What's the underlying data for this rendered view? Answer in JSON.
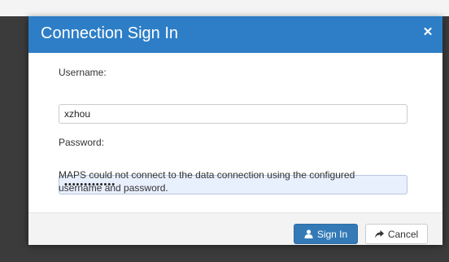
{
  "dialog": {
    "title": "Connection Sign In",
    "close_icon": "close-icon",
    "username_label": "Username:",
    "username_value": "xzhou",
    "password_label": "Password:",
    "password_value": "•••••••••••••",
    "message": "MAPS could not connect to the data connection using the configured username and password.",
    "sign_in_label": "Sign In",
    "sign_in_icon": "user-icon",
    "cancel_label": "Cancel",
    "cancel_icon": "share-arrow-icon"
  },
  "colors": {
    "header": "#2d7ec6",
    "primary_button": "#337ab7",
    "password_fill": "#e8f0fe",
    "backdrop": "#3b3b3b"
  }
}
